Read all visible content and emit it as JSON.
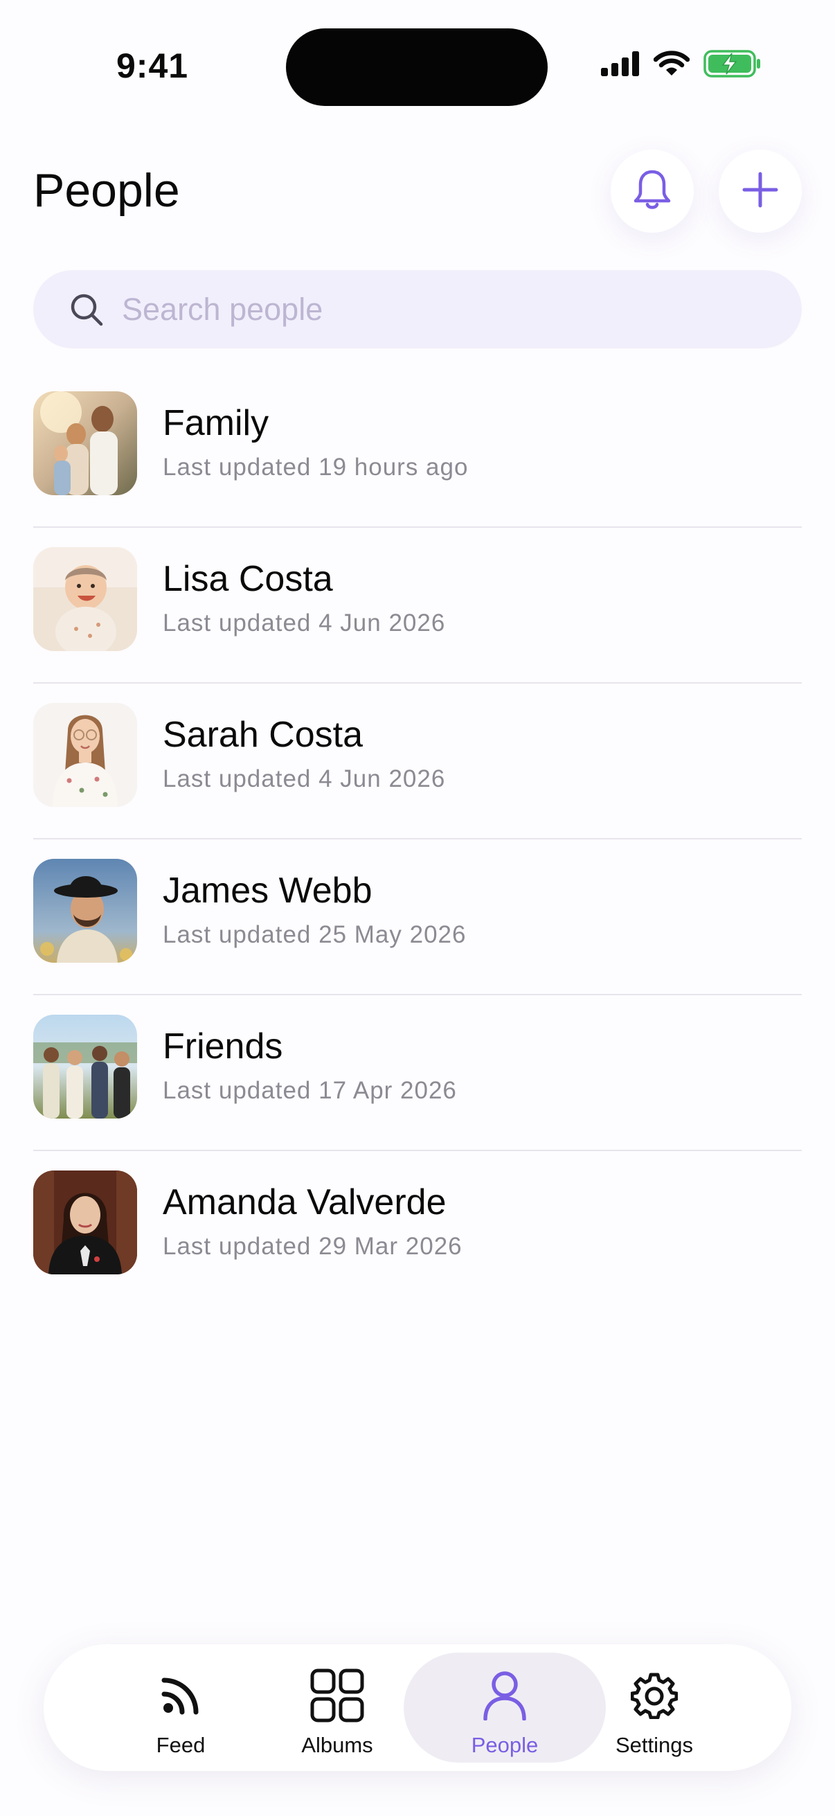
{
  "status_bar": {
    "time": "9:41",
    "icons": [
      "cellular-signal-icon",
      "wifi-icon",
      "battery-charging-icon"
    ]
  },
  "header": {
    "title": "People",
    "actions": [
      {
        "icon": "bell-icon",
        "label": ""
      },
      {
        "icon": "plus-icon",
        "label": ""
      }
    ]
  },
  "search": {
    "placeholder": "Search people",
    "value": ""
  },
  "people": [
    {
      "name": "Family",
      "subtitle": "Last updated 19 hours ago"
    },
    {
      "name": "Lisa Costa",
      "subtitle": "Last updated 4 Jun 2026"
    },
    {
      "name": "Sarah Costa",
      "subtitle": "Last updated 4 Jun 2026"
    },
    {
      "name": "James Webb",
      "subtitle": "Last updated 25 May 2026"
    },
    {
      "name": "Friends",
      "subtitle": "Last updated 17 Apr 2026"
    },
    {
      "name": "Amanda Valverde",
      "subtitle": "Last updated 29 Mar 2026"
    }
  ],
  "tab_bar": {
    "tabs": [
      {
        "label": "Feed",
        "icon": "rss-feed-icon",
        "active": false
      },
      {
        "label": "Albums",
        "icon": "grid-icon",
        "active": false
      },
      {
        "label": "People",
        "icon": "person-icon",
        "active": true
      },
      {
        "label": "Settings",
        "icon": "gear-icon",
        "active": false
      }
    ]
  },
  "colors": {
    "accent": "#7a5ee4",
    "search_background": "#f2effc",
    "background": "#fdfcfe",
    "secondary_text": "#8c8a92"
  }
}
